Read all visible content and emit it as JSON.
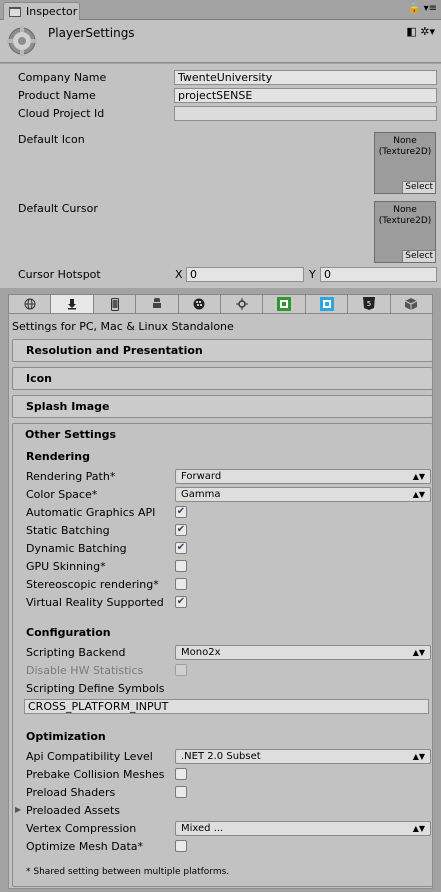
{
  "window": {
    "tab_label": "Inspector",
    "tab_right_icons": "🔒 ▾≡"
  },
  "header": {
    "title": "PlayerSettings",
    "icons": "◧ ✲▾"
  },
  "fields": {
    "company_label": "Company Name",
    "company_value": "TwenteUniversity",
    "product_label": "Product Name",
    "product_value": "projectSENSE",
    "cloud_label": "Cloud Project Id",
    "cloud_value": "",
    "icon_label": "Default Icon",
    "cursor_label": "Default Cursor",
    "texture_none": "None",
    "texture_type": "(Texture2D)",
    "select": "Select",
    "hotspot_label": "Cursor Hotspot",
    "hotspot_x_label": "X",
    "hotspot_x": "0",
    "hotspot_y_label": "Y",
    "hotspot_y": "0"
  },
  "platforms": [
    "globe-icon",
    "download-icon",
    "phone-icon",
    "android-icon",
    "blackberry-icon",
    "tizen-icon",
    "xbox-icon",
    "windows-store-icon",
    "html5-icon",
    "webgl-icon"
  ],
  "settings_for": "Settings for PC, Mac & Linux Standalone",
  "sections": {
    "resolution": "Resolution and Presentation",
    "icon": "Icon",
    "splash": "Splash Image",
    "other": "Other Settings"
  },
  "rendering": {
    "title": "Rendering",
    "path_label": "Rendering Path*",
    "path_value": "Forward",
    "color_label": "Color Space*",
    "color_value": "Gamma",
    "auto_api": "Automatic Graphics API",
    "static_batching": "Static Batching",
    "dynamic_batching": "Dynamic Batching",
    "gpu_skinning": "GPU Skinning*",
    "stereo": "Stereoscopic rendering*",
    "vr": "Virtual Reality Supported"
  },
  "configuration": {
    "title": "Configuration",
    "backend_label": "Scripting Backend",
    "backend_value": "Mono2x",
    "hw_stats": "Disable HW Statistics",
    "define_label": "Scripting Define Symbols",
    "define_value": "CROSS_PLATFORM_INPUT"
  },
  "optimization": {
    "title": "Optimization",
    "api_label": "Api Compatibility Level",
    "api_value": ".NET 2.0 Subset",
    "prebake": "Prebake Collision Meshes",
    "preload_shaders": "Preload Shaders",
    "preloaded_assets": "Preloaded Assets",
    "vertex_label": "Vertex Compression",
    "vertex_value": "Mixed ...",
    "optimize_mesh": "Optimize Mesh Data*"
  },
  "checks": {
    "auto_api": true,
    "static_batching": true,
    "dynamic_batching": true,
    "gpu_skinning": false,
    "stereo": false,
    "vr": true,
    "hw_stats": false,
    "prebake": false,
    "preload_shaders": false,
    "optimize_mesh": false
  },
  "footnote": "* Shared setting between multiple platforms."
}
